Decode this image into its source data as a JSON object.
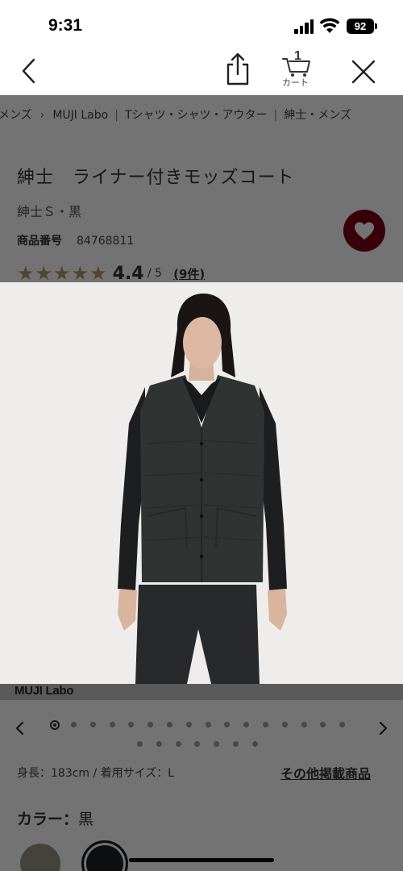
{
  "status_bar": {
    "time": "9:31",
    "battery": "92",
    "icons": [
      "signal-icon",
      "wifi-icon",
      "battery-icon"
    ]
  },
  "nav": {
    "icons": [
      "back-chevron-icon",
      "share-icon",
      "cart-icon",
      "close-icon"
    ],
    "cart_count": "1",
    "cart_label": "カート"
  },
  "breadcrumb": {
    "items": [
      "メンズ",
      "MUJI Labo",
      "Tシャツ・シャツ・アウター",
      "紳士・メンズ"
    ]
  },
  "product": {
    "title": "紳士　ライナー付きモッズコート",
    "variant": "紳士Ｓ・黒",
    "sku_label": "商品番号",
    "sku_value": "84768811",
    "rating_stars": "★★★★★",
    "rating_score": "4.4",
    "rating_max": " / 5",
    "review_count": "(9件)"
  },
  "image": {
    "brand_label": "MUJI Labo",
    "alt": "product photo",
    "total_images": 23,
    "current_index": 1
  },
  "model_info": "身長：183cm / 着用サイズ：L",
  "other_items_link": "その他掲載商品",
  "color": {
    "label": "カラー：",
    "value": "黒",
    "swatches": [
      "#9a9084",
      "#1d2123"
    ]
  },
  "colors": {
    "favorite": "#7d0019",
    "star": "#b59a68",
    "image_bg": "#eeedeb"
  }
}
